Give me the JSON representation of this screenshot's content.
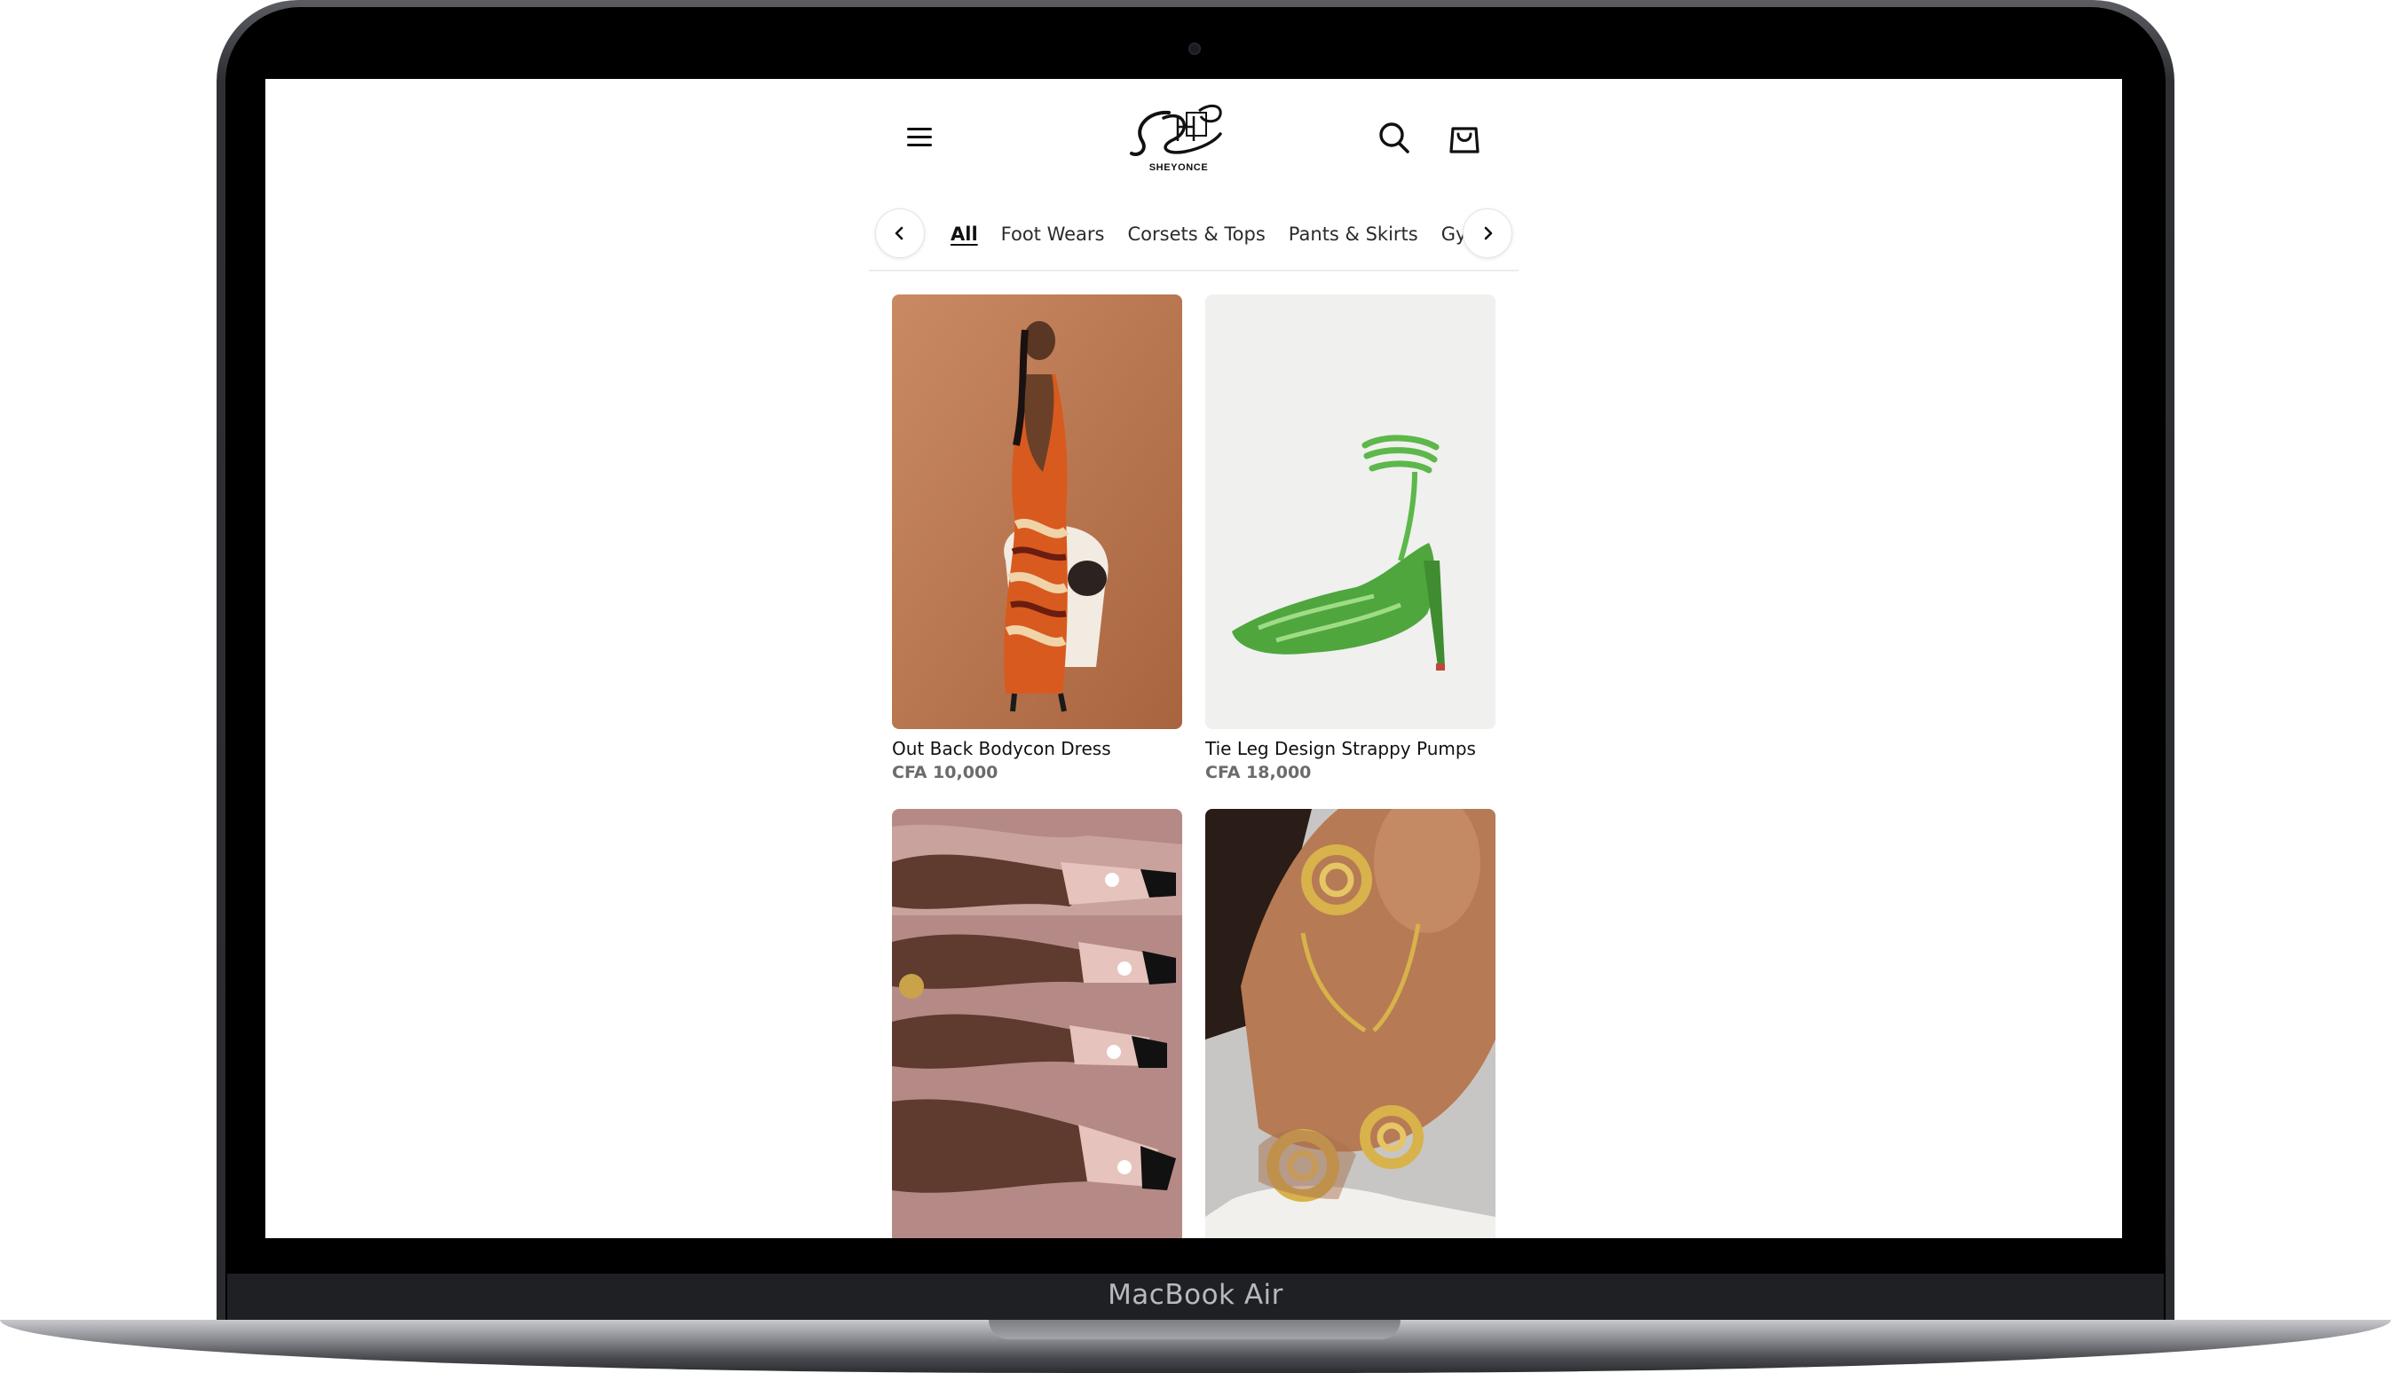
{
  "device": {
    "model_label": "MacBook Air"
  },
  "header": {
    "menu_icon": "hamburger-menu-icon",
    "logo_text": "SHEYONCE",
    "search_icon": "search-icon",
    "cart_icon": "shopping-bag-icon"
  },
  "categories": {
    "prev_icon": "chevron-left-icon",
    "next_icon": "chevron-right-icon",
    "items": [
      "All",
      "Foot Wears",
      "Corsets & Tops",
      "Pants & Skirts",
      "Gym"
    ],
    "active": "All"
  },
  "products": [
    {
      "name": "Out Back Bodycon Dress",
      "price": "CFA 10,000"
    },
    {
      "name": "Tie Leg Design Strappy Pumps",
      "price": "CFA 18,000"
    },
    {
      "name": "",
      "price": ""
    },
    {
      "name": "",
      "price": ""
    }
  ],
  "colors": {
    "text": "#111111",
    "price": "#6b6b6b",
    "divider": "#ececec",
    "shoe_green": "#5cb84a"
  }
}
